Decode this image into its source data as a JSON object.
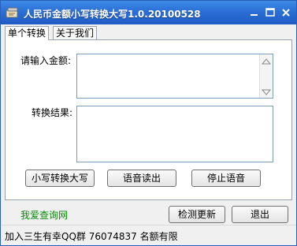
{
  "window": {
    "title": "人民币金额小写转换大写1.0.20100528"
  },
  "tabs": [
    {
      "label": "单个转换"
    },
    {
      "label": "关于我们"
    }
  ],
  "form": {
    "input_label": "请输入金额:",
    "input_value": "",
    "result_label": "转换结果:",
    "result_value": ""
  },
  "buttons": {
    "convert": "小写转换大写",
    "read_aloud": "语音读出",
    "stop_voice": "停止语音",
    "check_update": "检测更新",
    "exit": "退出"
  },
  "footer": {
    "link": "我爱查询网",
    "status": "加入三生有幸QQ群 76074837 名额有限"
  },
  "colors": {
    "title_bar": "#2b6fd6",
    "link": "#0a8a0a"
  }
}
